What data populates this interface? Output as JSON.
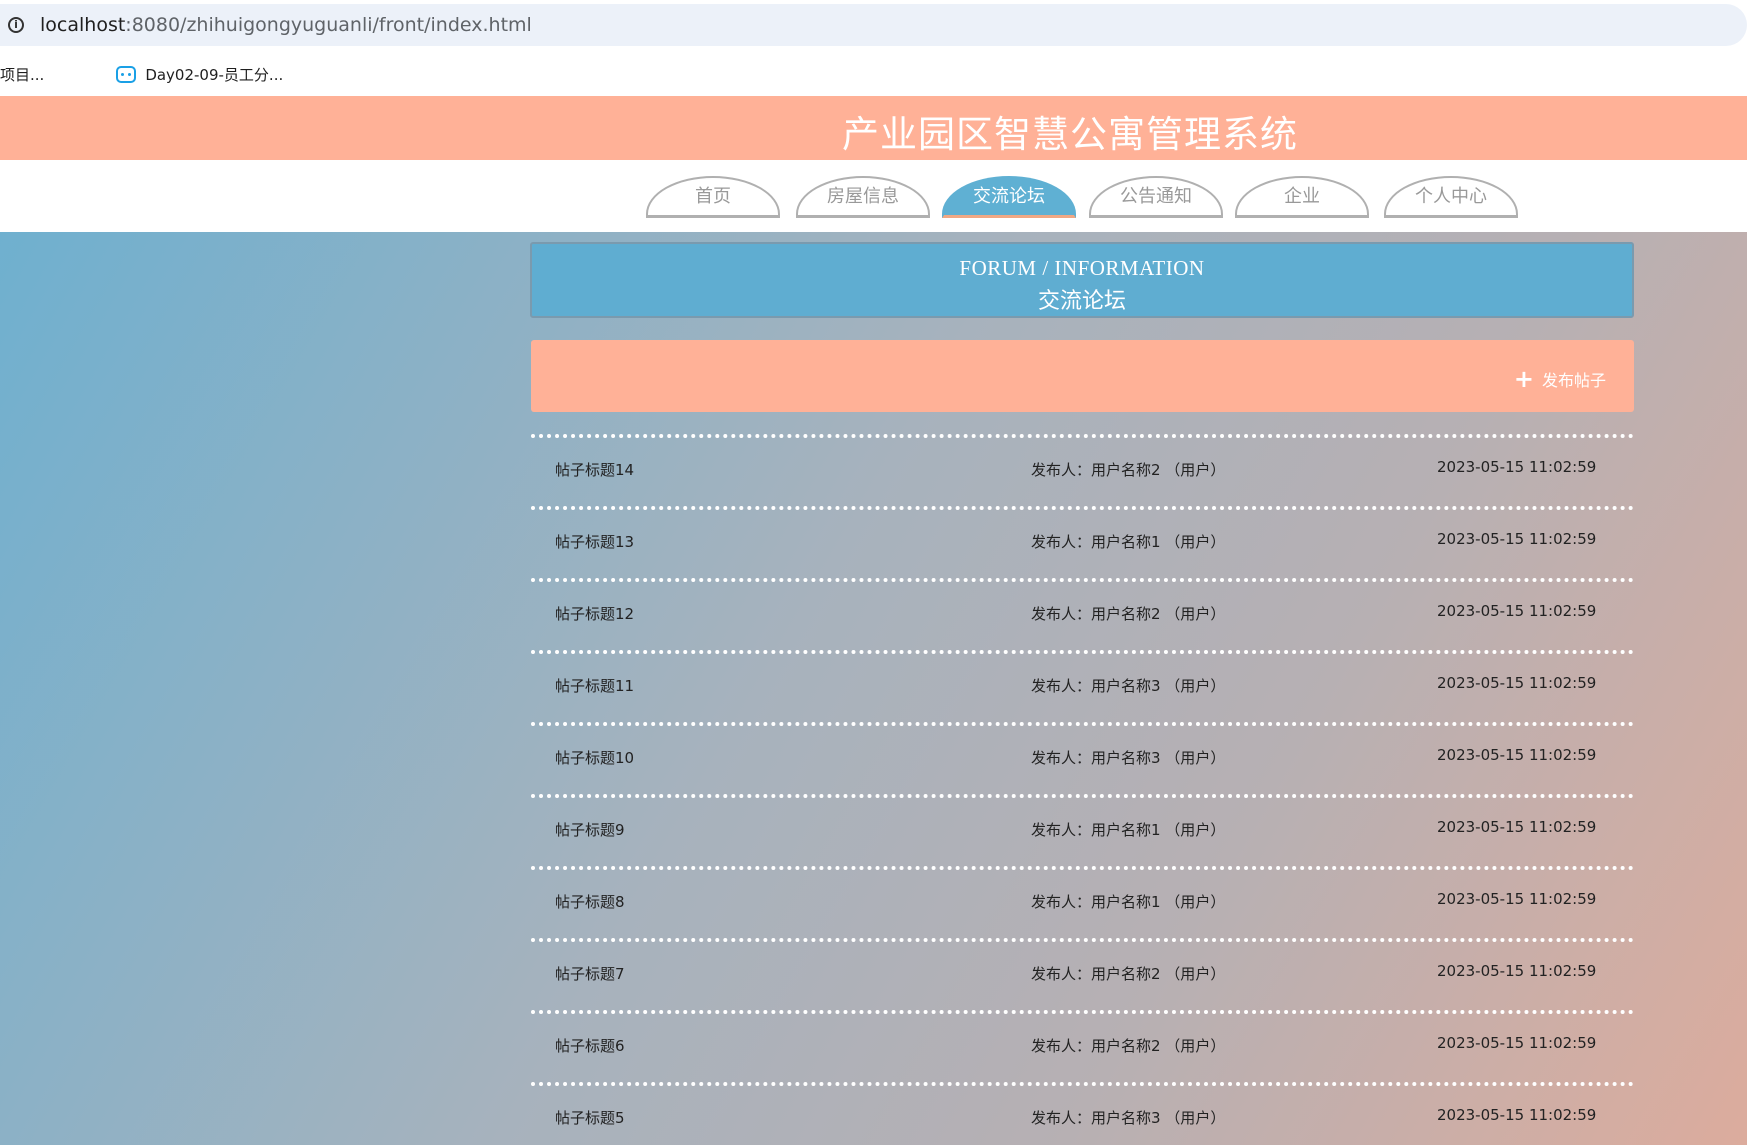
{
  "browser": {
    "url_host": "localhost",
    "url_rest": ":8080/zhihuigongyuguanli/front/index.html",
    "bookmarks": [
      {
        "label": "项目..."
      },
      {
        "label": "Day02-09-员工分..."
      }
    ]
  },
  "header": {
    "title": "产业园区智慧公寓管理系统"
  },
  "nav": {
    "tabs": [
      {
        "label": "首页",
        "active": false
      },
      {
        "label": "房屋信息",
        "active": false
      },
      {
        "label": "交流论坛",
        "active": true
      },
      {
        "label": "公告通知",
        "active": false
      },
      {
        "label": "企业",
        "active": false
      },
      {
        "label": "个人中心",
        "active": false
      }
    ]
  },
  "banner": {
    "english": "FORUM / INFORMATION",
    "chinese": "交流论坛"
  },
  "actions": {
    "publish_label": "发布帖子"
  },
  "posts": [
    {
      "title": "帖子标题14",
      "author": "发布人：用户名称2 （用户）",
      "time": "2023-05-15 11:02:59"
    },
    {
      "title": "帖子标题13",
      "author": "发布人：用户名称1 （用户）",
      "time": "2023-05-15 11:02:59"
    },
    {
      "title": "帖子标题12",
      "author": "发布人：用户名称2 （用户）",
      "time": "2023-05-15 11:02:59"
    },
    {
      "title": "帖子标题11",
      "author": "发布人：用户名称3 （用户）",
      "time": "2023-05-15 11:02:59"
    },
    {
      "title": "帖子标题10",
      "author": "发布人：用户名称3 （用户）",
      "time": "2023-05-15 11:02:59"
    },
    {
      "title": "帖子标题9",
      "author": "发布人：用户名称1 （用户）",
      "time": "2023-05-15 11:02:59"
    },
    {
      "title": "帖子标题8",
      "author": "发布人：用户名称1 （用户）",
      "time": "2023-05-15 11:02:59"
    },
    {
      "title": "帖子标题7",
      "author": "发布人：用户名称2 （用户）",
      "time": "2023-05-15 11:02:59"
    },
    {
      "title": "帖子标题6",
      "author": "发布人：用户名称2 （用户）",
      "time": "2023-05-15 11:02:59"
    },
    {
      "title": "帖子标题5",
      "author": "发布人：用户名称3 （用户）",
      "time": "2023-05-15 11:02:59"
    }
  ],
  "colors": {
    "header_bg": "#ffb197",
    "active_tab": "#5fb0d3",
    "banner_bg": "#5fadd1"
  }
}
